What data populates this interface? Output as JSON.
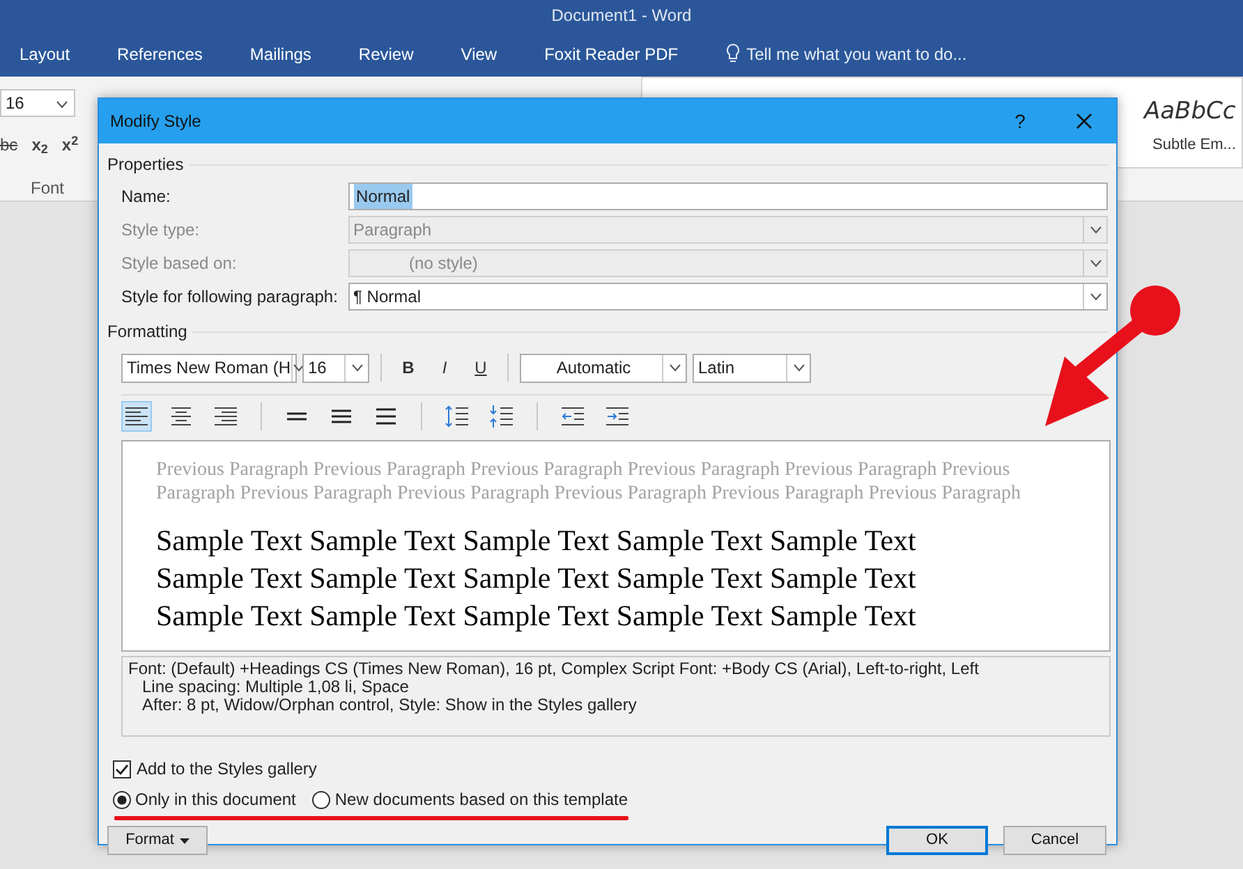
{
  "app": {
    "title": "Document1 - Word",
    "tabs": [
      {
        "label": "Layout"
      },
      {
        "label": "References"
      },
      {
        "label": "Mailings"
      },
      {
        "label": "Review"
      },
      {
        "label": "View"
      },
      {
        "label": "Foxit Reader PDF"
      }
    ],
    "tell_me": "Tell me what you want to do...",
    "ribbon": {
      "font_size": "16",
      "strike_label": "bc",
      "subscript": "x$_{2}$",
      "superscript": "x$^{2}$",
      "group_label": "Font",
      "style_preview": "AaBbCc",
      "style_name": "Subtle Em..."
    }
  },
  "dialog": {
    "title": "Modify Style",
    "help": "?",
    "properties": {
      "label": "Properties",
      "rows": [
        {
          "label": "Name:",
          "value": "Normal",
          "kind": "text",
          "disabled": false,
          "highlighted": true
        },
        {
          "label": "Style type:",
          "value": "Paragraph",
          "kind": "select",
          "disabled": true,
          "highlighted": false
        },
        {
          "label": "Style based on:",
          "value": "(no style)",
          "kind": "select",
          "disabled": true,
          "highlighted": false
        },
        {
          "label": "Style for following paragraph:",
          "glyph": "¶",
          "value": "Normal",
          "kind": "select",
          "disabled": false,
          "highlighted": false
        }
      ]
    },
    "formatting": {
      "label": "Formatting",
      "font": "Times New Roman (H",
      "size": "16",
      "font_color": "Automatic",
      "script": "Latin",
      "styles": [
        {
          "label": "B",
          "kind": "bold",
          "on": false
        },
        {
          "label": "I",
          "kind": "italic",
          "on": false
        },
        {
          "label": "U",
          "kind": "underline",
          "on": false
        }
      ],
      "alignment": [
        {
          "kind": "left",
          "selected": true
        },
        {
          "kind": "center",
          "selected": false
        },
        {
          "kind": "right",
          "selected": false
        },
        {
          "kind": "justify-single",
          "selected": false
        },
        {
          "kind": "justify-mid",
          "selected": false
        },
        {
          "kind": "justify",
          "selected": false
        }
      ]
    },
    "preview": {
      "previous": "Previous Paragraph Previous Paragraph Previous Paragraph Previous Paragraph Previous Paragraph Previous Paragraph Previous Paragraph Previous Paragraph Previous Paragraph Previous Paragraph Previous Paragraph",
      "sample_lines": [
        "Sample Text Sample Text Sample Text Sample Text Sample Text",
        "Sample Text Sample Text Sample Text Sample Text Sample Text",
        "Sample Text Sample Text Sample Text Sample Text Sample Text"
      ]
    },
    "description": [
      "Font: (Default) +Headings CS (Times New Roman), 16 pt, Complex Script Font: +Body CS (Arial), Left-to-right, Left",
      "Line spacing:  Multiple 1,08 li, Space",
      "After:  8 pt, Widow/Orphan control, Style: Show in the Styles gallery"
    ],
    "add_to_gallery": {
      "label": "Add to the Styles gallery",
      "checked": true
    },
    "scope": [
      {
        "label": "Only in this document",
        "selected": true
      },
      {
        "label": "New documents based on this template",
        "selected": false
      }
    ],
    "buttons": {
      "format": "Format",
      "ok": "OK",
      "cancel": "Cancel"
    }
  }
}
